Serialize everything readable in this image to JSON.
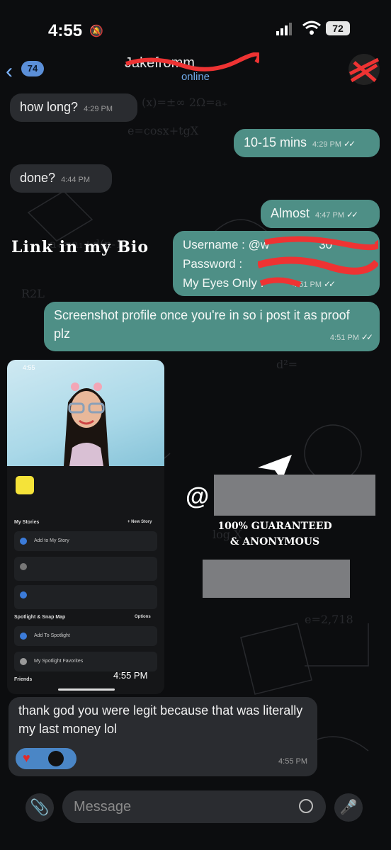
{
  "status_bar": {
    "time": "4:55",
    "battery": "72"
  },
  "header": {
    "back_count": "74",
    "contact_name": "Jakefrom",
    "contact_suffix": "m",
    "presence": "online"
  },
  "messages": [
    {
      "text": "how long?",
      "time": "4:29 PM"
    },
    {
      "text": "10-15 mins",
      "time": "4:29 PM"
    },
    {
      "text": "done?",
      "time": "4:44 PM"
    },
    {
      "text": "Almost",
      "time": "4:47 PM"
    },
    {
      "line1": "Username : @w",
      "line1_end": "30",
      "line2": "Password : ",
      "line3": "My Eyes Only : ",
      "time": "4:51 PM"
    },
    {
      "text": "Screenshot profile once you're in so i post it as proof plz",
      "time": "4:51 PM"
    },
    {
      "time": "4:55 PM"
    },
    {
      "text": "thank god you were legit because that was literally my last money lol",
      "time": "4:55 PM"
    }
  ],
  "overlay": {
    "link_in_bio": "Link in my Bio",
    "at_sign": "@",
    "guarantee_line1": "100% GUARANTEED",
    "guarantee_line2": "& ANONYMOUS"
  },
  "snap_screenshot": {
    "time": "4:55",
    "section_stories": "My Stories",
    "new_story": "+ New Story",
    "add_to_story": "Add to My Story",
    "spotlight": "Spotlight & Snap Map",
    "options": "Options",
    "add_spotlight": "Add To Spotlight",
    "favorites": "My Spotlight Favorites",
    "friends": "Friends"
  },
  "composer": {
    "placeholder": "Message"
  },
  "colors": {
    "outgoing": "#4e8f86",
    "incoming": "#2a2c30",
    "accent": "#6fa8e6"
  }
}
